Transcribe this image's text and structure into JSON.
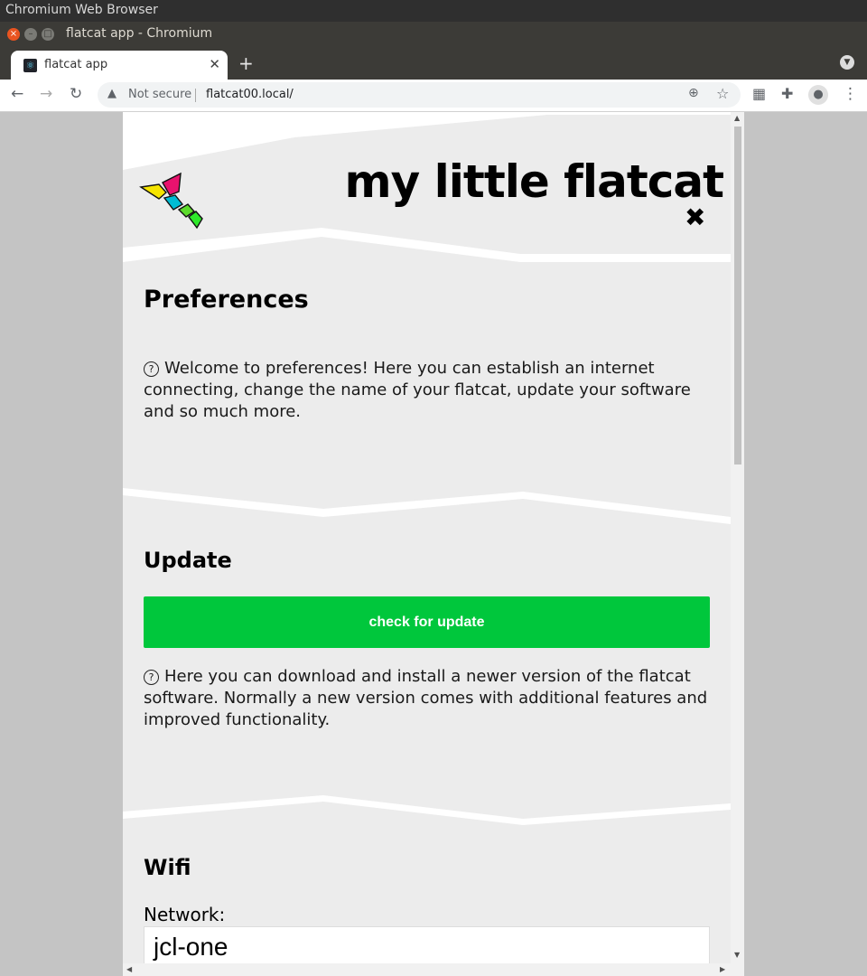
{
  "os": {
    "title": "Chromium Web Browser"
  },
  "window": {
    "title": "flatcat app - Chromium"
  },
  "tab": {
    "title": "flatcat app"
  },
  "toolbar": {
    "security": "Not secure",
    "url": "flatcat00.local/"
  },
  "app": {
    "title": "my little flatcat",
    "close_symbol": "✖",
    "logo_colors": [
      "#f5e400",
      "#e8126e",
      "#00bcd4",
      "#5ddb2c",
      "#2ee82a"
    ],
    "accent_color": "#00c73c"
  },
  "preferences": {
    "title": "Preferences",
    "help_text": "Welcome to preferences! Here you can establish an internet connecting, change the name of your flatcat, update your software and so much more."
  },
  "update": {
    "title": "Update",
    "button_label": "check for update",
    "help_text": "Here you can download and install a newer version of the flatcat software. Normally a new version comes with additional features and improved functionality."
  },
  "wifi": {
    "title": "Wifi",
    "network_label": "Network:",
    "network_value": "jcl-one"
  },
  "icons": [
    "back-icon",
    "forward-icon",
    "reload-icon",
    "warning-icon",
    "zoom-icon",
    "star-icon",
    "tab-search-icon",
    "extensions-icon",
    "profile-icon",
    "menu-icon",
    "question-icon"
  ]
}
